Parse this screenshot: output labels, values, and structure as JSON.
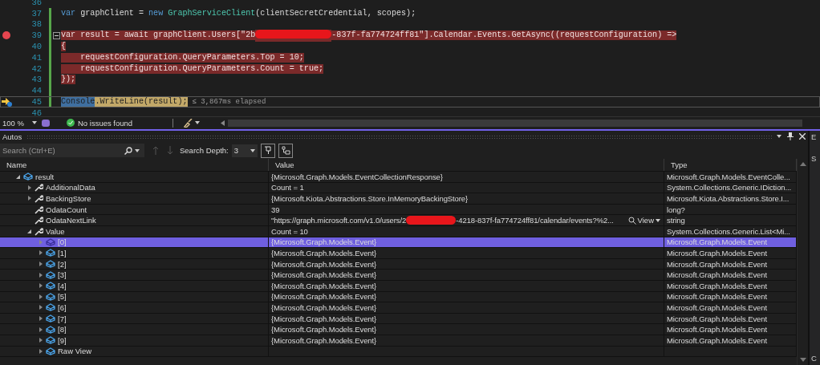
{
  "editor": {
    "lines": [
      {
        "number": "36",
        "changed": false,
        "breakpoint": false,
        "current_statement": false,
        "collapsible": false
      },
      {
        "number": "37",
        "changed": true,
        "breakpoint": false,
        "in_breakpoint": false,
        "current_statement": false,
        "collapsible": false,
        "segments": [
          {
            "text": "var ",
            "kind": "keyword"
          },
          {
            "text": "graphClient = ",
            "kind": "plain"
          },
          {
            "text": "new ",
            "kind": "keyword"
          },
          {
            "text": "GraphServiceClient",
            "kind": "type"
          },
          {
            "text": "(clientSecretCredential, scopes);",
            "kind": "plain"
          }
        ]
      },
      {
        "number": "38",
        "changed": true,
        "breakpoint": false,
        "current_statement": false,
        "collapsible": false
      },
      {
        "number": "39",
        "changed": true,
        "breakpoint": true,
        "in_breakpoint": true,
        "current_statement": false,
        "collapsible": true,
        "segments": [
          {
            "text": "var result = await graphClient.Users[\"2b",
            "kind": "plain"
          },
          {
            "kind": "redacted"
          },
          {
            "text": "-837f-fa774724ff81\"].Calendar.Events.GetAsync((requestConfiguration) =>",
            "kind": "plain"
          }
        ]
      },
      {
        "number": "40",
        "changed": true,
        "breakpoint": false,
        "in_breakpoint": true,
        "current_statement": false,
        "collapsible": false,
        "segments": [
          {
            "text": "{",
            "kind": "plain"
          }
        ]
      },
      {
        "number": "41",
        "changed": true,
        "breakpoint": false,
        "in_breakpoint": true,
        "current_statement": false,
        "collapsible": false,
        "segments": [
          {
            "text": "    requestConfiguration.QueryParameters.Top = 10;",
            "kind": "plain"
          }
        ]
      },
      {
        "number": "42",
        "changed": true,
        "breakpoint": false,
        "in_breakpoint": true,
        "current_statement": false,
        "collapsible": false,
        "segments": [
          {
            "text": "    requestConfiguration.QueryParameters.Count = true;",
            "kind": "plain"
          }
        ]
      },
      {
        "number": "43",
        "changed": true,
        "breakpoint": false,
        "in_breakpoint": true,
        "current_statement": false,
        "collapsible": false,
        "segments": [
          {
            "text": "});",
            "kind": "plain"
          }
        ]
      },
      {
        "number": "44",
        "changed": true,
        "breakpoint": false,
        "current_statement": false,
        "collapsible": false
      },
      {
        "number": "45",
        "changed": true,
        "breakpoint": false,
        "in_breakpoint": false,
        "current_statement": true,
        "collapsible": false,
        "segments": [
          {
            "text": "Console",
            "kind": "plain",
            "selected": true
          },
          {
            "text": ".WriteLine(result);",
            "kind": "plain",
            "selected": false
          }
        ],
        "hint": "≤ 3,867ms elapsed"
      },
      {
        "number": "46",
        "changed": false,
        "breakpoint": false,
        "current_statement": false,
        "collapsible": false
      }
    ]
  },
  "status_bar": {
    "zoom": "100 %",
    "issues": "No issues found"
  },
  "autos": {
    "title": "Autos",
    "search": {
      "placeholder": "Search (Ctrl+E)"
    },
    "search_depth_label": "Search Depth:",
    "search_depth": "3",
    "columns": [
      "Name",
      "Value",
      "Type"
    ],
    "rows": [
      {
        "name": "result",
        "kind": "object",
        "expanded": true,
        "selected": false,
        "value": [
          {
            "text": "{Microsoft.Graph.Models.EventCollectionResponse}"
          }
        ],
        "type": "Microsoft.Graph.Models.EventColle...",
        "children": [
          {
            "name": "AdditionalData",
            "kind": "property",
            "expanded": false,
            "selected": false,
            "value": [
              {
                "text": "Count = 1"
              }
            ],
            "type": "System.Collections.Generic.IDiction..."
          },
          {
            "name": "BackingStore",
            "kind": "property",
            "expanded": false,
            "selected": false,
            "value": [
              {
                "text": "{Microsoft.Kiota.Abstractions.Store.InMemoryBackingStore}"
              }
            ],
            "type": "Microsoft.Kiota.Abstractions.Store.I..."
          },
          {
            "name": "OdataCount",
            "kind": "property",
            "selected": false,
            "value": [
              {
                "text": "39"
              }
            ],
            "type": "long?"
          },
          {
            "name": "OdataNextLink",
            "kind": "property",
            "selected": false,
            "value": [
              {
                "text": "\"https://graph.microsoft.com/v1.0/users/2"
              },
              {
                "kind": "redacted"
              },
              {
                "text": "-4218-837f-fa774724ff81/calendar/events?%2..."
              }
            ],
            "view_button": "View",
            "type": "string"
          },
          {
            "name": "Value",
            "kind": "property",
            "expanded": true,
            "selected": false,
            "value": [
              {
                "text": "Count = 10"
              }
            ],
            "type": "System.Collections.Generic.List<Mi...",
            "children": [
              {
                "name": "[0]",
                "kind": "object",
                "expanded": false,
                "selected": true,
                "value": [
                  {
                    "text": "{Microsoft.Graph.Models.Event}"
                  }
                ],
                "type": "Microsoft.Graph.Models.Event"
              },
              {
                "name": "[1]",
                "kind": "object",
                "expanded": false,
                "selected": false,
                "value": [
                  {
                    "text": "{Microsoft.Graph.Models.Event}"
                  }
                ],
                "type": "Microsoft.Graph.Models.Event"
              },
              {
                "name": "[2]",
                "kind": "object",
                "expanded": false,
                "selected": false,
                "value": [
                  {
                    "text": "{Microsoft.Graph.Models.Event}"
                  }
                ],
                "type": "Microsoft.Graph.Models.Event"
              },
              {
                "name": "[3]",
                "kind": "object",
                "expanded": false,
                "selected": false,
                "value": [
                  {
                    "text": "{Microsoft.Graph.Models.Event}"
                  }
                ],
                "type": "Microsoft.Graph.Models.Event"
              },
              {
                "name": "[4]",
                "kind": "object",
                "expanded": false,
                "selected": false,
                "value": [
                  {
                    "text": "{Microsoft.Graph.Models.Event}"
                  }
                ],
                "type": "Microsoft.Graph.Models.Event"
              },
              {
                "name": "[5]",
                "kind": "object",
                "expanded": false,
                "selected": false,
                "value": [
                  {
                    "text": "{Microsoft.Graph.Models.Event}"
                  }
                ],
                "type": "Microsoft.Graph.Models.Event"
              },
              {
                "name": "[6]",
                "kind": "object",
                "expanded": false,
                "selected": false,
                "value": [
                  {
                    "text": "{Microsoft.Graph.Models.Event}"
                  }
                ],
                "type": "Microsoft.Graph.Models.Event"
              },
              {
                "name": "[7]",
                "kind": "object",
                "expanded": false,
                "selected": false,
                "value": [
                  {
                    "text": "{Microsoft.Graph.Models.Event}"
                  }
                ],
                "type": "Microsoft.Graph.Models.Event"
              },
              {
                "name": "[8]",
                "kind": "object",
                "expanded": false,
                "selected": false,
                "value": [
                  {
                    "text": "{Microsoft.Graph.Models.Event}"
                  }
                ],
                "type": "Microsoft.Graph.Models.Event"
              },
              {
                "name": "[9]",
                "kind": "object",
                "expanded": false,
                "selected": false,
                "value": [
                  {
                    "text": "{Microsoft.Graph.Models.Event}"
                  }
                ],
                "type": "Microsoft.Graph.Models.Event"
              },
              {
                "name": "Raw View",
                "kind": "object",
                "expanded": false,
                "selected": false
              }
            ]
          }
        ]
      }
    ]
  },
  "side_panel": {
    "texts": [
      "E",
      "S",
      "C"
    ]
  }
}
